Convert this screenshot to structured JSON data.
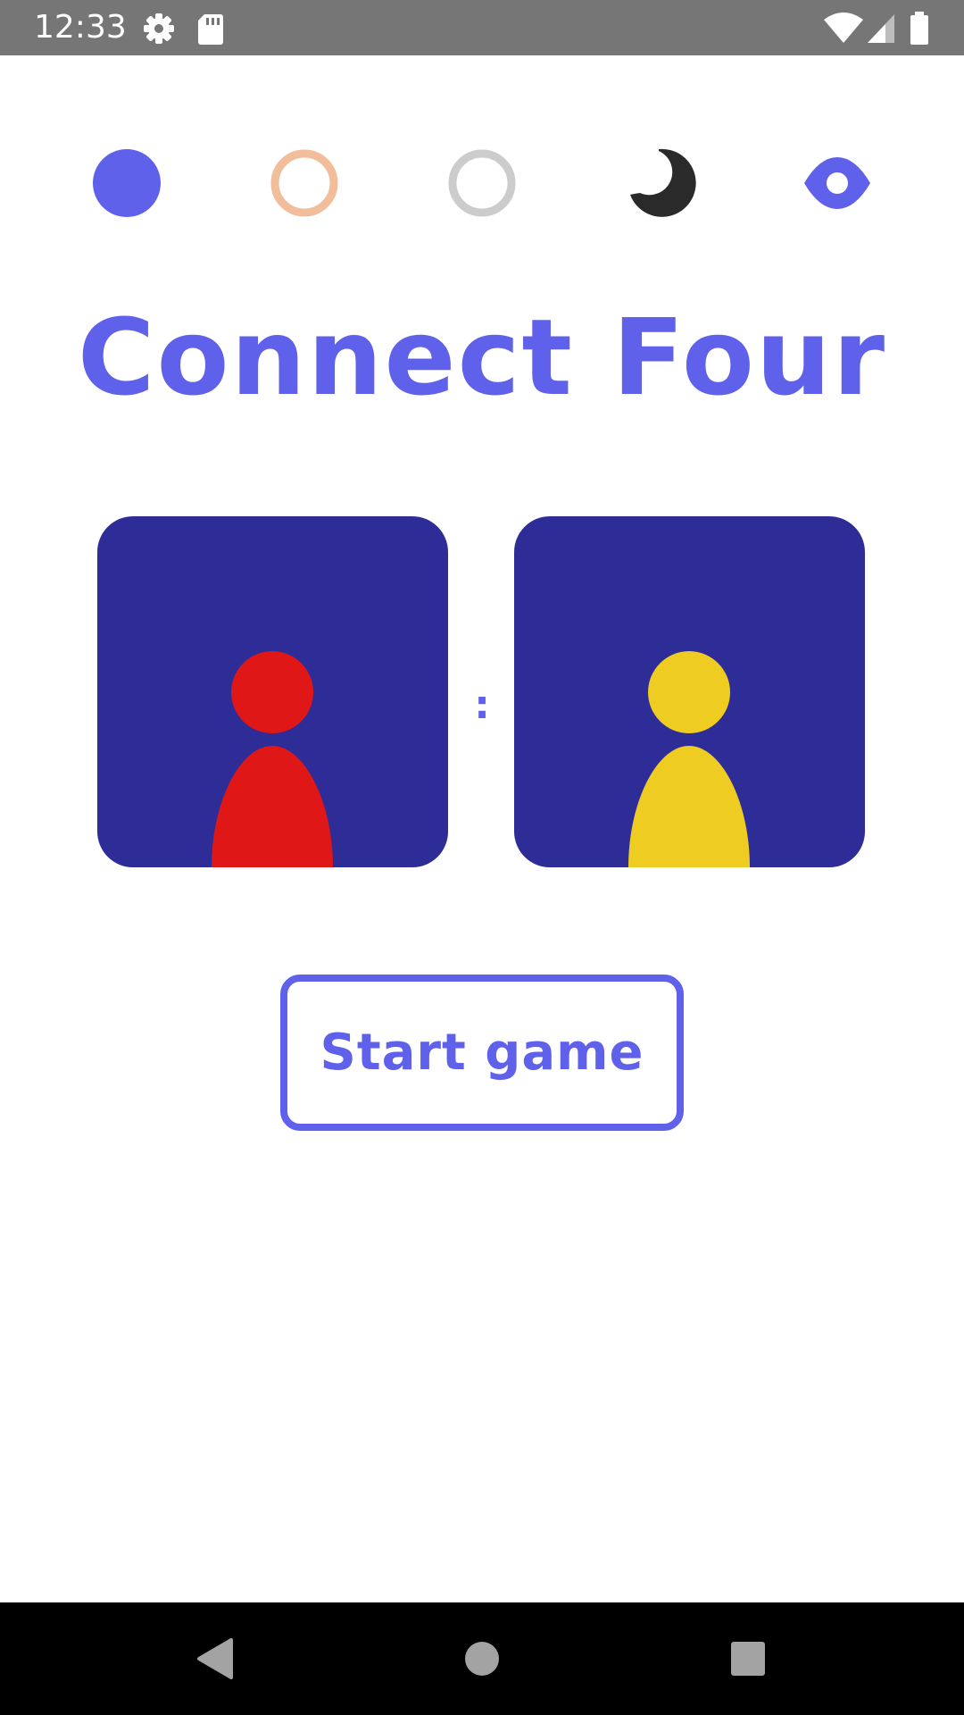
{
  "status_bar": {
    "time": "12:33",
    "left_icons": [
      "settings-icon",
      "sd-card-icon"
    ],
    "right_icons": [
      "wifi-icon",
      "cellular-signal-icon",
      "battery-icon"
    ]
  },
  "theme_options": [
    {
      "name": "theme-option-filled-circle",
      "icon": "filled-circle-icon",
      "color": "#6061ea"
    },
    {
      "name": "theme-option-peach-ring",
      "icon": "ring-icon",
      "color": "#f1bd9a"
    },
    {
      "name": "theme-option-gray-ring",
      "icon": "ring-icon",
      "color": "#cccccc"
    },
    {
      "name": "theme-option-dark-moon",
      "icon": "moon-icon",
      "color": "#2a2a2a"
    },
    {
      "name": "theme-option-eye",
      "icon": "eye-icon",
      "color": "#6061ea"
    }
  ],
  "title": "Connect Four",
  "players": {
    "separator": ":",
    "player_one": {
      "icon": "person-icon",
      "color": "#e01717"
    },
    "player_two": {
      "icon": "person-icon",
      "color": "#efcc22"
    }
  },
  "colors": {
    "accent": "#6061ea",
    "card_background": "#2e2d98"
  },
  "start_button": {
    "label": "Start game"
  },
  "nav_bar": {
    "buttons": [
      "back-icon",
      "home-icon",
      "recents-icon"
    ]
  }
}
